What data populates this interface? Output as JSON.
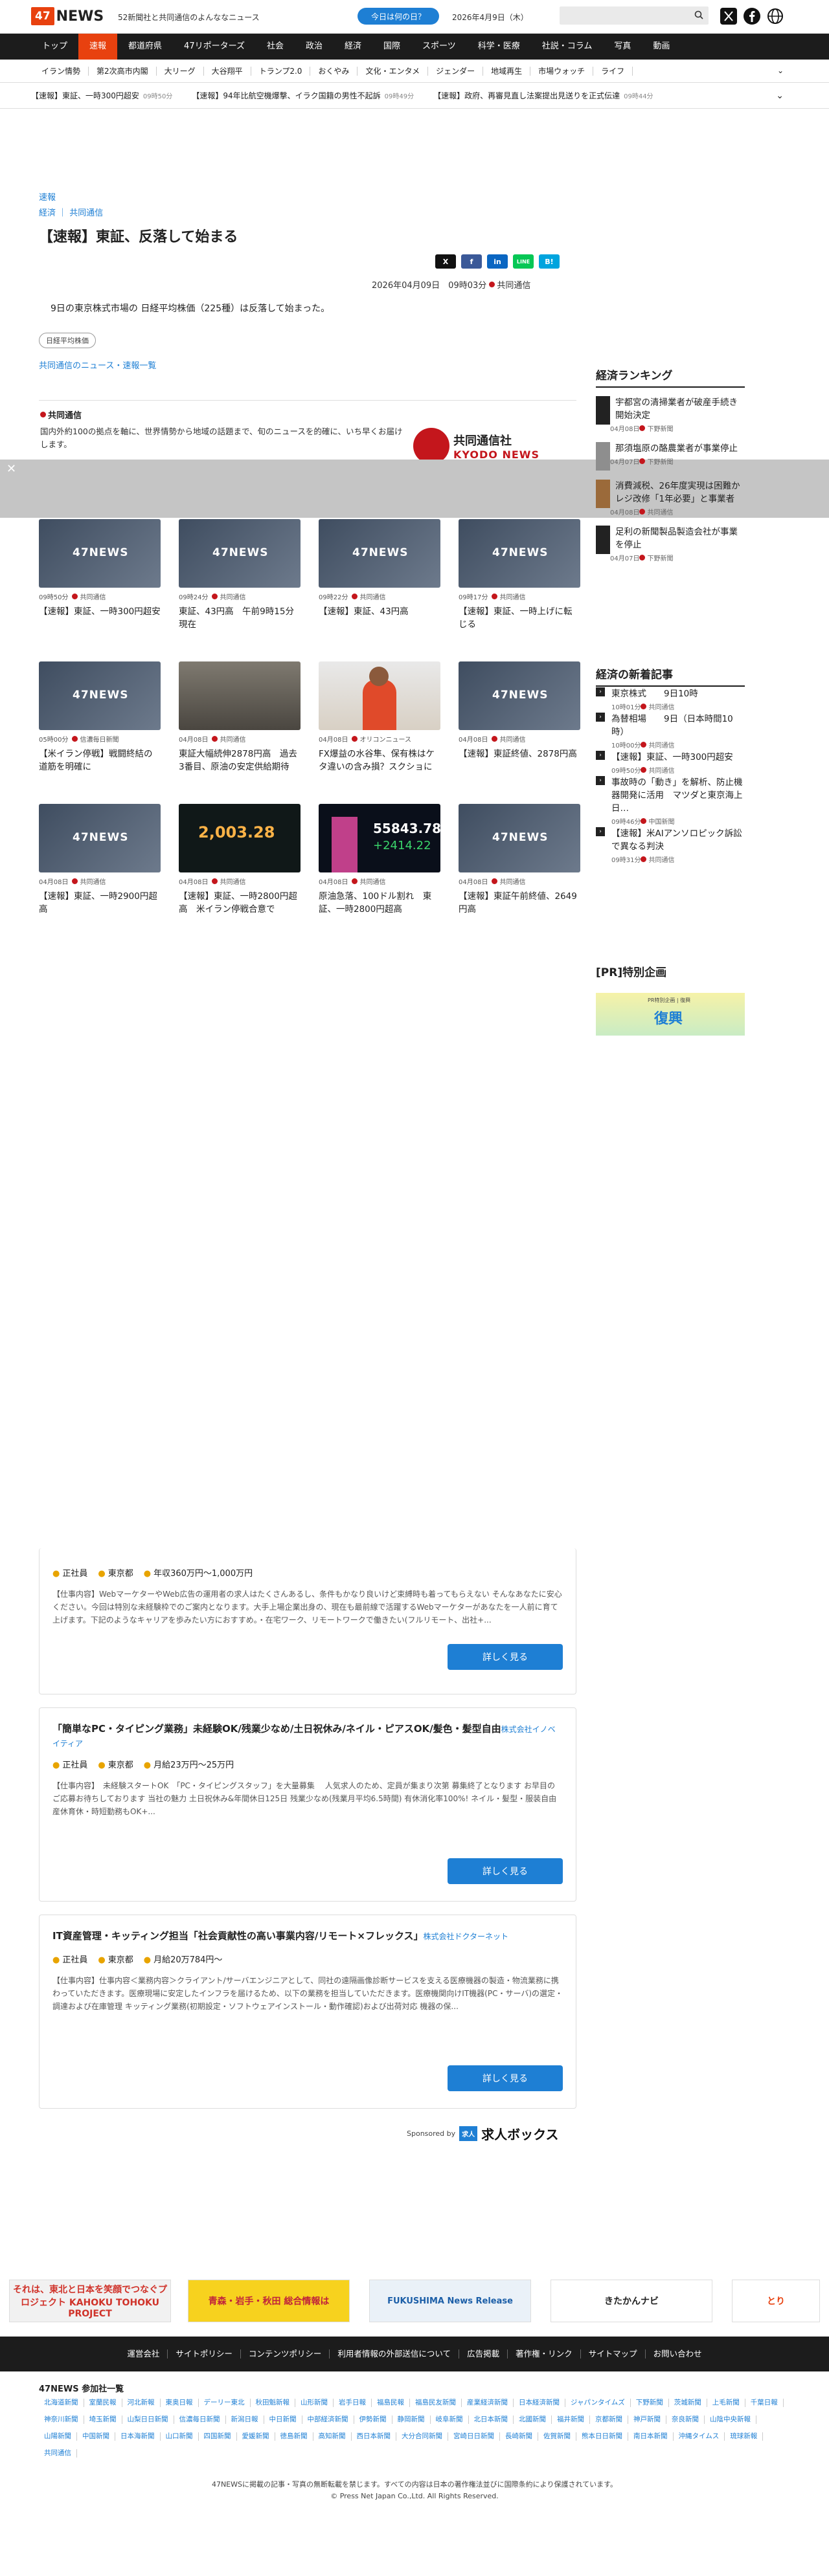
{
  "header": {
    "logo": "47NEWS",
    "tagline": "52新聞社と共同通信のよんななニュース",
    "today_button": "今日は何の日？",
    "date": "2026年4月9日（木）",
    "search_placeholder": ""
  },
  "nav": [
    "トップ",
    "速報",
    "都道府県",
    "47リポーターズ",
    "社会",
    "政治",
    "経済",
    "国際",
    "スポーツ",
    "科学・医療",
    "社説・コラム",
    "写真",
    "動画"
  ],
  "subnav": [
    "イラン情勢",
    "第2次高市内閣",
    "大リーグ",
    "大谷翔平",
    "トランプ2.0",
    "おくやみ",
    "文化・エンタメ",
    "ジェンダー",
    "地域再生",
    "市場ウォッチ",
    "ライフ"
  ],
  "ticker": [
    {
      "text": "【速報】東証、一時300円超安",
      "time": "09時50分"
    },
    {
      "text": "【速報】94年比航空機爆撃、イラク国籍の男性不起訴",
      "time": "09時49分"
    },
    {
      "text": "【速報】政府、再審見直し法案提出見送りを正式伝達",
      "time": "09時44分"
    }
  ],
  "article": {
    "kicker": "速報",
    "breadcrumb": [
      "経済",
      "共同通信"
    ],
    "title": "【速報】東証、反落して始まる",
    "meta": "2026年04月09日　09時03分",
    "source": "共同通信",
    "lead": "9日の東京株式市場の 日経平均株価（225種）は反落して始まった。",
    "tag": "日経平均株価",
    "more_link": "共同通信のニュース・速報一覧",
    "share": [
      "X",
      "f",
      "in",
      "LINE",
      "B!"
    ]
  },
  "kyodo": {
    "name": "共同通信",
    "description": "国内外約100の拠点を軸に、世界情勢から地域の話題まで、旬のニュースを的確に、いち早くお届けします。",
    "logo_circle": "一般社団法人",
    "logo_name": "共同通信社",
    "logo_en": "KYODO NEWS"
  },
  "cards": [
    {
      "img": "news",
      "time": "09時50分",
      "src": "共同通信",
      "title": "【速報】東証、一時300円超安"
    },
    {
      "img": "news",
      "time": "09時24分",
      "src": "共同通信",
      "title": "東証、43円高　午前9時15分現在"
    },
    {
      "img": "news",
      "time": "09時22分",
      "src": "共同通信",
      "title": "【速報】東証、43円高"
    },
    {
      "img": "news",
      "time": "09時17分",
      "src": "共同通信",
      "title": "【速報】東証、一時上げに転じる"
    },
    {
      "img": "news",
      "time": "05時00分",
      "src": "信濃毎日新聞",
      "title": "【米イラン停戦】戦闘終結の道筋を明確に"
    },
    {
      "img": "stock",
      "time": "04月08日",
      "src": "共同通信",
      "title": "東証大幅続伸2878円高　過去3番目、原油の安定供給期待"
    },
    {
      "img": "person",
      "time": "04月08日",
      "src": "オリコンニュース",
      "title": "FX爆益の水谷隼、保有株はケタ違いの含み損？スクショに反響「利確…"
    },
    {
      "img": "news",
      "time": "04月08日",
      "src": "共同通信",
      "title": "【速報】東証終値、2878円高"
    },
    {
      "img": "news",
      "time": "04月08日",
      "src": "共同通信",
      "title": "【速報】東証、一時2900円超高"
    },
    {
      "img": "board",
      "time": "04月08日",
      "src": "共同通信",
      "title": "【速報】東証、一時2800円超高　米イラン停戦合意で56000円台…",
      "val": "2,003.28"
    },
    {
      "img": "board2",
      "time": "04月08日",
      "src": "共同通信",
      "title": "原油急落、100ドル割れ　東証、一時2800円超高",
      "val": "55843.78",
      "val2": "+2414.22"
    },
    {
      "img": "news",
      "time": "04月08日",
      "src": "共同通信",
      "title": "【速報】東証午前終値、2649円高"
    }
  ],
  "sidebar": {
    "ranking_title": "経済ランキング",
    "ranking": [
      {
        "title": "宇都宮の清掃業者が破産手続き開始決定",
        "meta": "04月08日",
        "src": "下野新聞"
      },
      {
        "title": "那須塩原の酪農業者が事業停止",
        "meta": "04月07日",
        "src": "下野新聞"
      },
      {
        "title": "消費減税、26年度実現は困難か　レジ改修「1年必要」と事業者",
        "meta": "04月08日",
        "src": "共同通信"
      },
      {
        "title": "足利の新聞製品製造会社が事業を停止",
        "meta": "04月07日",
        "src": "下野新聞"
      }
    ],
    "new_title": "経済の新着記事",
    "new": [
      {
        "title": "東京株式　　9日10時",
        "meta": "10時01分",
        "src": "共同通信"
      },
      {
        "title": "為替相場　　9日（日本時間10時）",
        "meta": "10時00分",
        "src": "共同通信"
      },
      {
        "title": "【速報】東証、一時300円超安",
        "meta": "09時50分",
        "src": "共同通信"
      },
      {
        "title": "事故時の「動き」を解析、防止機器開発に活用　マツダと東京海上日…",
        "meta": "09時46分",
        "src": "中国新聞"
      },
      {
        "title": "【速報】米AIアンソロピック訴訟で異なる判決",
        "meta": "09時31分",
        "src": "共同通信"
      }
    ],
    "pr_title": "[PR]特別企画",
    "pr_small": "PR特別企画 | 復興",
    "pr_big": "復興"
  },
  "jobs": [
    {
      "title": "",
      "company": "",
      "type": "正社員",
      "place": "東京都",
      "salary": "年収360万円〜1,000万円",
      "desc": "【仕事内容】WebマーケターやWeb広告の運用者の求人はたくさんあるし、条件もかなり良いけど束縛時も着ってもらえない そんなあなたに安心ください。今回は特別な未経験枠でのご案内となります。大手上場企業出身の、現在も最前線で活躍するWebマーケターがあなたを一人前に育て上げます。下記のようなキャリアを歩みたい方におすすめ。・在宅ワーク、リモートワークで働きたい(フルリモート、出社+...",
      "button": "詳しく見る"
    },
    {
      "title": "「簡単なPC・タイピング業務」未経験OK/残業少なめ/土日祝休み/ネイル・ピアスOK/髪色・髪型自由",
      "company": "株式会社イノベイティア",
      "type": "正社員",
      "place": "東京都",
      "salary": "月給23万円〜25万円",
      "desc": "【仕事内容】　未経験スタートOK　「PC・タイピングスタッフ」を大量募集 　人気求人のため、定員が集まり次第 募集終了となります お早目のご応募お待ちしております 当社の魅力 土日祝休み&年間休日125日 残業少なめ(残業月平均6.5時間) 有休消化率100%! ネイル・髪型・服装自由 産休育休・時短勤務もOK+...",
      "button": "詳しく見る"
    },
    {
      "title": "IT資産管理・キッティング担当「社会貢献性の高い事業内容/リモート×フレックス」",
      "company": "株式会社ドクターネット",
      "type": "正社員",
      "place": "東京都",
      "salary": "月給20万784円〜",
      "desc": "【仕事内容】仕事内容＜業務内容＞クライアント/サーバエンジニアとして、同社の遠隔画像診断サービスを支える医療機器の製造・物流業務に携わっていただきます。医療現場に安定したインフラを届けるため、以下の業務を担当していただきます。医療機関向けIT機器(PC・サーバ)の選定・調達および在庫管理 キッティング業務(初期設定・ソフトウェアインストール・動作確認)および出荷対応 機器の保...",
      "button": "詳しく見る"
    }
  ],
  "sponsor": {
    "label": "Sponsored by",
    "badge": "求人",
    "name": "求人ボックス"
  },
  "banners": [
    {
      "text": "それは、東北と日本を笑顔でつなぐプロジェクト KAHOKU TOHOKU PROJECT",
      "color": "#f1f1f1",
      "fg": "#d0332a"
    },
    {
      "text": "青森・岩手・秋田 総合情報は",
      "color": "#f7d21e",
      "fg": "#c0223b"
    },
    {
      "text": "FUKUSHIMA News Release",
      "color": "#eaf1f8",
      "fg": "#1c5fa8"
    },
    {
      "text": "きたかんナビ",
      "color": "#ffffff",
      "fg": "#222"
    },
    {
      "text": "とり",
      "color": "#ffffff",
      "fg": "#e8410f"
    }
  ],
  "footer": {
    "nav": [
      "運営会社",
      "サイトポリシー",
      "コンテンツポリシー",
      "利用者情報の外部送信について",
      "広告掲載",
      "著作権・リンク",
      "サイトマップ",
      "お問い合わせ"
    ],
    "members_title": "47NEWS 参加社一覧",
    "members": [
      "北海道新聞",
      "室蘭民報",
      "河北新報",
      "東奥日報",
      "デーリー東北",
      "秋田魁新報",
      "山形新聞",
      "岩手日報",
      "福島民報",
      "福島民友新聞",
      "産業経済新聞",
      "日本経済新聞",
      "ジャパンタイムズ",
      "下野新聞",
      "茨城新聞",
      "上毛新聞",
      "千葉日報",
      "神奈川新聞",
      "埼玉新聞",
      "山梨日日新聞",
      "信濃毎日新聞",
      "新潟日報",
      "中日新聞",
      "中部経済新聞",
      "伊勢新聞",
      "静岡新聞",
      "岐阜新聞",
      "北日本新聞",
      "北國新聞",
      "福井新聞",
      "京都新聞",
      "神戸新聞",
      "奈良新聞",
      "山陰中央新報",
      "山陽新聞",
      "中国新聞",
      "日本海新聞",
      "山口新聞",
      "四国新聞",
      "愛媛新聞",
      "徳島新聞",
      "高知新聞",
      "西日本新聞",
      "大分合同新聞",
      "宮崎日日新聞",
      "長崎新聞",
      "佐賀新聞",
      "熊本日日新聞",
      "南日本新聞",
      "沖縄タイムス",
      "琉球新報",
      "共同通信"
    ],
    "copy1": "47NEWSに掲載の記事・写真の無断転載を禁じます。すべての内容は日本の著作権法並びに国際条約により保護されています。",
    "copy2": "© Press Net Japan Co.,Ltd. All Rights Reserved."
  }
}
